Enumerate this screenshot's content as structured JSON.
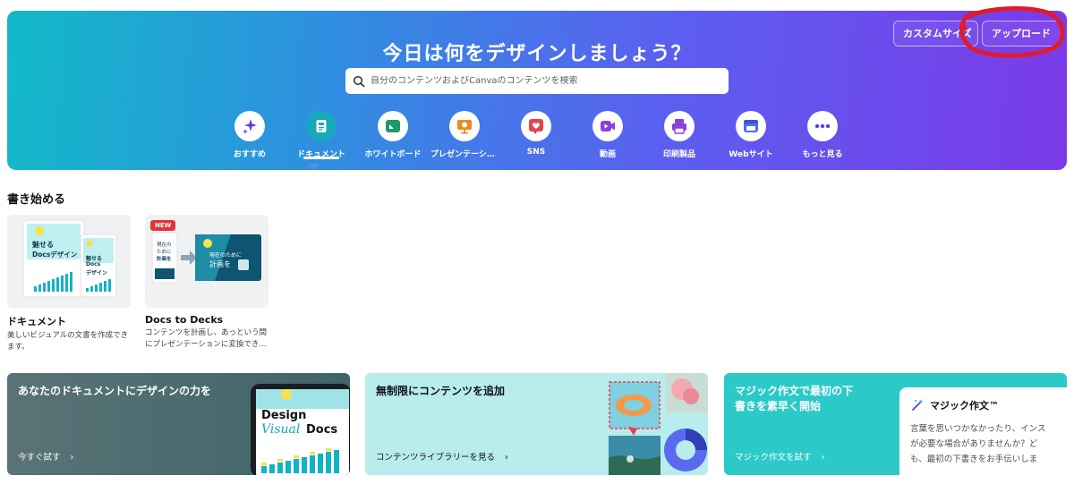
{
  "hero": {
    "title": "今日は何をデザインしましょう？",
    "custom_size_label": "カスタムサイズ",
    "upload_label": "アップロード",
    "search_placeholder": "自分のコンテンツおよびCanvaのコンテンツを検索",
    "annotation_color": "#e01b2d"
  },
  "categories": [
    {
      "label": "おすすめ",
      "icon": "sparkle-icon",
      "color": "#5b3ee0"
    },
    {
      "label": "ドキュメント",
      "icon": "document-icon",
      "color": "#13a3b5",
      "active": true
    },
    {
      "label": "ホワイトボード",
      "icon": "whiteboard-icon",
      "color": "#1a9b6c"
    },
    {
      "label": "プレゼンテーション",
      "icon": "presentation-icon",
      "color": "#f08a1c"
    },
    {
      "label": "SNS",
      "icon": "heart-icon",
      "color": "#e8414b"
    },
    {
      "label": "動画",
      "icon": "video-icon",
      "color": "#8a3fe0"
    },
    {
      "label": "印刷製品",
      "icon": "printer-icon",
      "color": "#8a3fe0"
    },
    {
      "label": "Webサイト",
      "icon": "website-icon",
      "color": "#4b6fe8"
    },
    {
      "label": "もっと見る",
      "icon": "more-icon",
      "color": "#5b3ee0"
    }
  ],
  "start_section": {
    "title": "書き始める",
    "cards": [
      {
        "name": "ドキュメント",
        "desc": "美しいビジュアルの文書を作成できます。",
        "thumb_text_1": "魅せる",
        "thumb_text_2": "Docsデザイン",
        "thumb_text_3": "魅せる",
        "thumb_text_4": "Docs",
        "thumb_text_5": "デザイン"
      },
      {
        "name": "Docs to Decks",
        "desc": "コンテンツを計画し、あっという間にプレゼンテーションに変換でき...",
        "badge": "NEW",
        "thumb_text_1": "現在の",
        "thumb_text_2": "ために",
        "thumb_text_3": "計画を",
        "thumb_text_4": "現在のために",
        "thumb_text_5": "計画を"
      }
    ]
  },
  "promos": [
    {
      "title": "あなたのドキュメントにデザインの力を",
      "link": "今すぐ試す",
      "art_text_1": "Design",
      "art_text_2": "Visual",
      "art_text_3": "Docs"
    },
    {
      "title": "無制限にコンテンツを追加",
      "link": "コンテンツライブラリーを見る"
    },
    {
      "title_line1": "マジック作文で最初の下",
      "title_line2": "書きを素早く開始",
      "link": "マジック作文を試す",
      "panel_title": "マジック作文™",
      "panel_line1": "言葉を思いつかなかったり、インス",
      "panel_line2": "が必要な場合がありませんか？ど",
      "panel_line3": "も、最初の下書きをお手伝いしま"
    }
  ]
}
